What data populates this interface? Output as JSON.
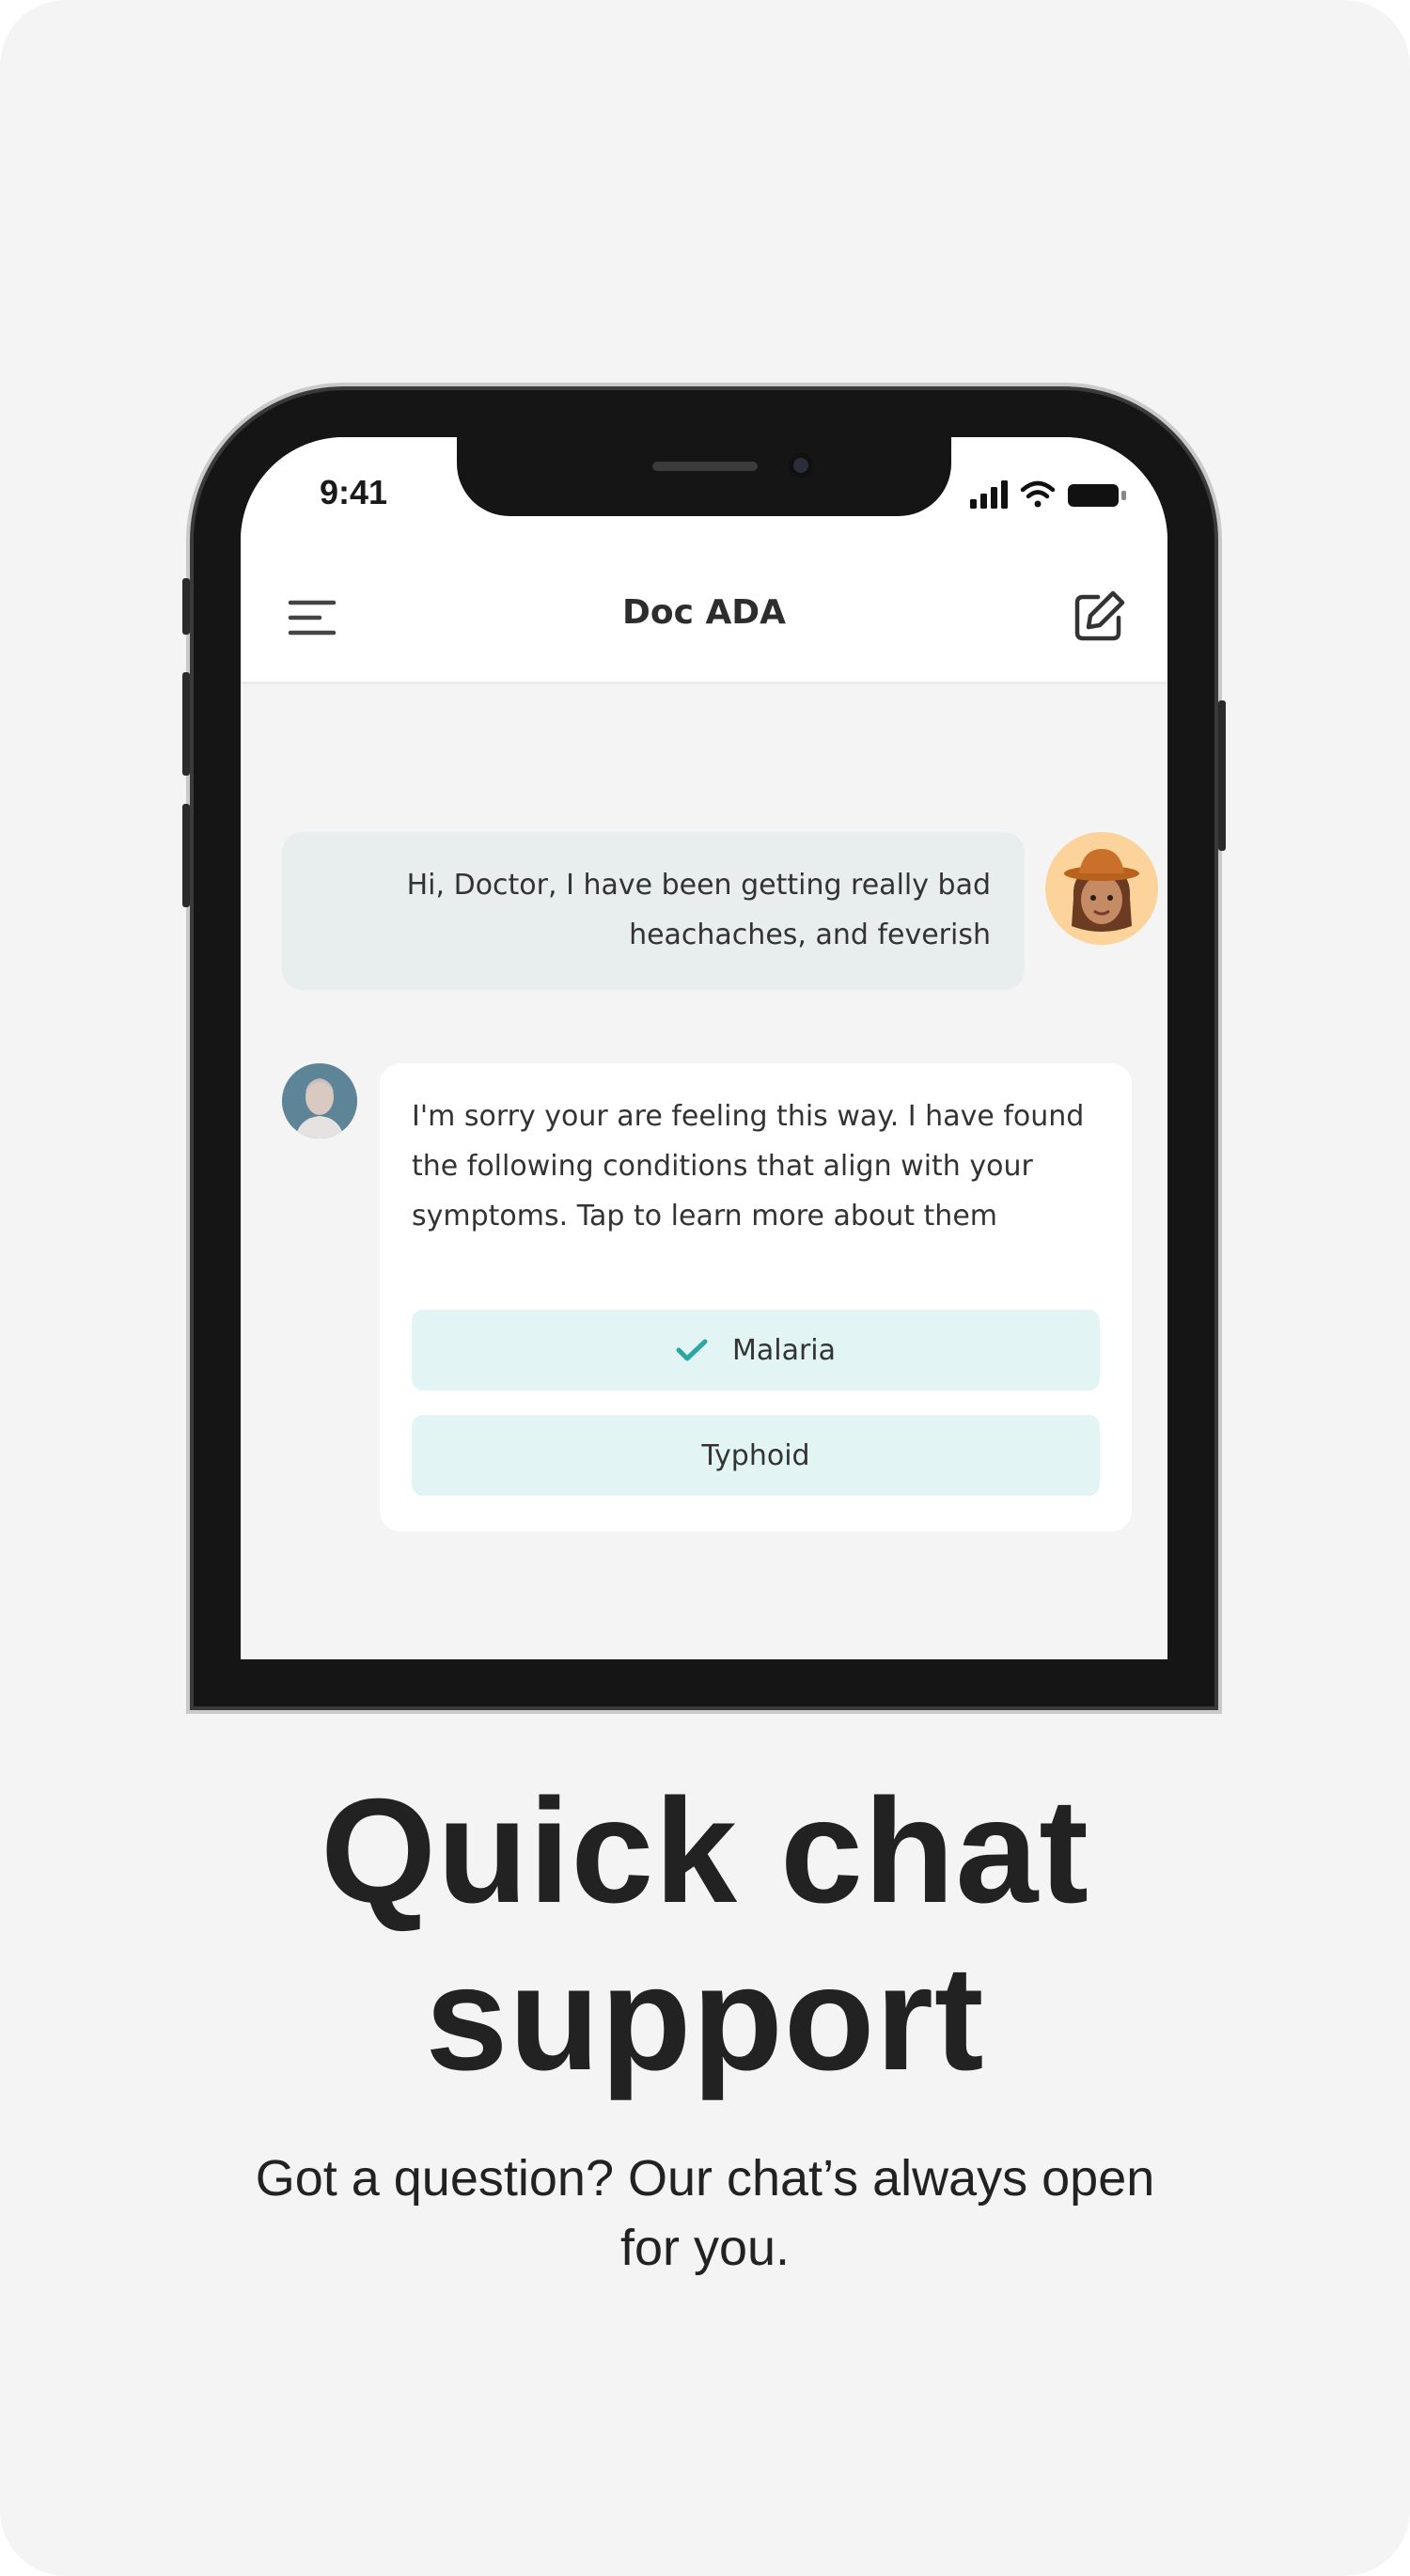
{
  "phone": {
    "status_time": "9:41",
    "app_title": "Doc ADA",
    "icons": {
      "menu": "hamburger-menu-icon",
      "edit": "compose-edit-icon",
      "signal": "cellular-signal-icon",
      "wifi": "wifi-icon",
      "battery": "battery-icon",
      "check": "checkmark-icon"
    },
    "messages": {
      "user_line1": "Hi, Doctor, I have been getting really bad",
      "user_line2": "heachaches, and feverish",
      "bot_text": "I'm sorry your are feeling this way. I have found the following conditions that align with your symptoms. Tap to learn more about them"
    },
    "options": [
      {
        "label": "Malaria",
        "selected": true
      },
      {
        "label": "Typhoid",
        "selected": false
      }
    ]
  },
  "hero": {
    "headline_line1": "Quick chat",
    "headline_line2": "support",
    "subtitle_line1": "Got a question? Our chat’s always open",
    "subtitle_line2": "for you."
  },
  "colors": {
    "background": "#f4f4f4",
    "option_fill": "#e3f4f4",
    "accent_teal": "#2aa7a7",
    "user_avatar_bg": "#fcd39a",
    "text_dark": "#222222"
  }
}
